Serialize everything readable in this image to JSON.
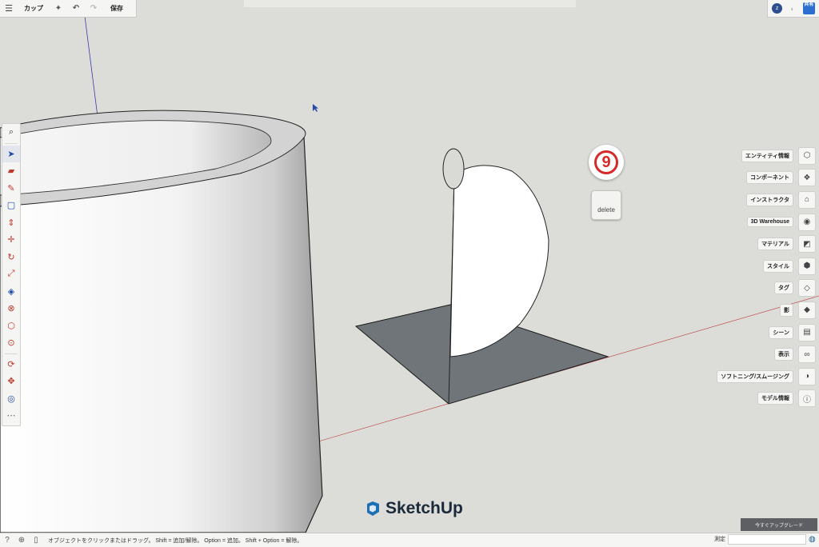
{
  "topbar": {
    "menu_icon": "hamburger-icon",
    "model_title": "カップ",
    "save_label": "保存"
  },
  "topright": {
    "avatar_initial": "z",
    "share_label": "共有"
  },
  "left_toolbar": {
    "tools": [
      "search-icon",
      "select-icon",
      "eraser-icon",
      "pencil-icon",
      "rectangle-icon",
      "push-pull-icon",
      "move-icon",
      "rotate-icon",
      "scale-icon",
      "paint-icon",
      "follow-me-icon",
      "offset-icon",
      "tape-icon",
      "orbit-icon",
      "pan-icon",
      "zoom-extents-icon",
      "more-icon"
    ],
    "more_label": "⋯"
  },
  "right_panel": {
    "items": [
      {
        "label": "エンティティ情報",
        "icon": "entity-info-icon"
      },
      {
        "label": "コンポーネント",
        "icon": "components-icon"
      },
      {
        "label": "インストラクタ",
        "icon": "instructor-icon"
      },
      {
        "label": "3D Warehouse",
        "icon": "warehouse-icon"
      },
      {
        "label": "マテリアル",
        "icon": "materials-icon"
      },
      {
        "label": "スタイル",
        "icon": "styles-icon"
      },
      {
        "label": "タグ",
        "icon": "tags-icon"
      },
      {
        "label": "影",
        "icon": "shadows-icon"
      },
      {
        "label": "シーン",
        "icon": "scenes-icon"
      },
      {
        "label": "表示",
        "icon": "display-icon"
      },
      {
        "label": "ソフトニング/スムージング",
        "icon": "softening-icon"
      },
      {
        "label": "モデル情報",
        "icon": "model-info-icon"
      }
    ]
  },
  "floating": {
    "key_badge": "9",
    "delete_label": "delete"
  },
  "branding": {
    "logo_text": "SketchUp",
    "upgrade_label": "今すぐアップグレード"
  },
  "statusbar": {
    "hint": "オブジェクトをクリックまたはドラッグ。 Shift = 追加/解除。 Option = 追加。 Shift + Option = 解除。",
    "measure_label": "測定",
    "measure_value": ""
  },
  "colors": {
    "background": "#dcdcd8",
    "accent_blue": "#2d6fd0",
    "badge_red": "#d62a2a",
    "face_gray": "#6f7579"
  }
}
